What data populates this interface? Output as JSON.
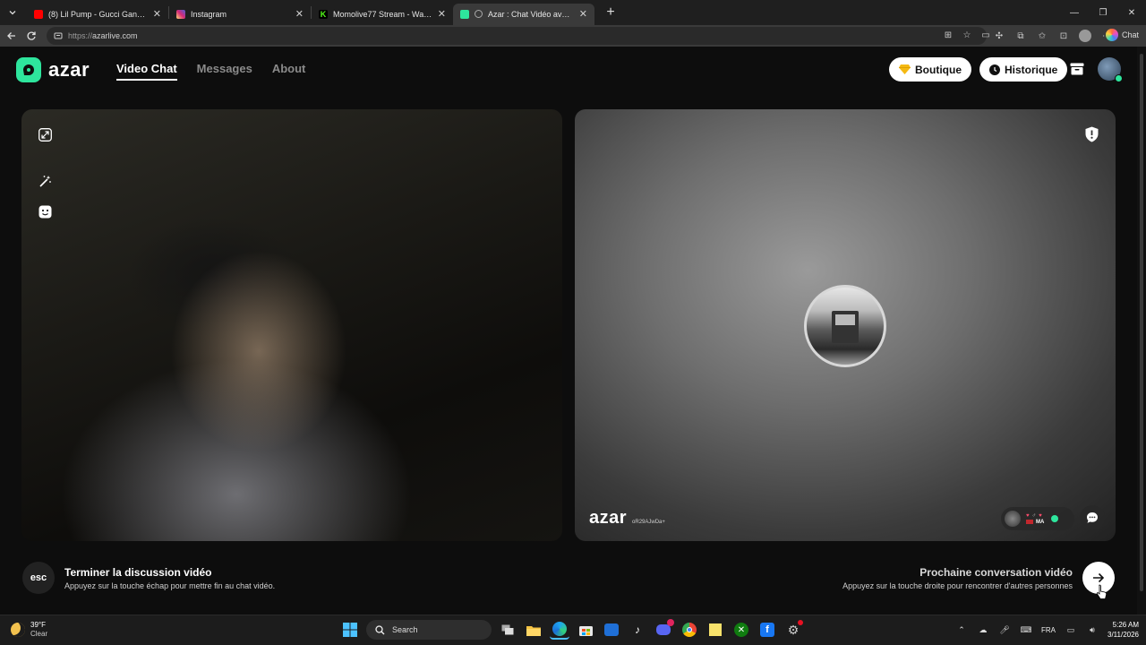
{
  "browser": {
    "tabs": [
      {
        "title": "(8) Lil Pump - Gucci Gang [Official",
        "icon": "youtube-icon",
        "color": "#ff0000"
      },
      {
        "title": "Instagram",
        "icon": "instagram-icon",
        "color": "#e1306c"
      },
      {
        "title": "Momolive77 Stream - Watch Live o",
        "icon": "kick-icon",
        "color": "#53fc18"
      },
      {
        "title": "Azar : Chat Vidéo avec de nou",
        "icon": "azar-icon",
        "color": "#2ee59d"
      }
    ],
    "url_prefix": "https://",
    "url_host": "azarlive.com",
    "copilot_label": "Chat"
  },
  "header": {
    "logo_text": "azar",
    "nav": [
      "Video Chat",
      "Messages",
      "About"
    ],
    "boutique_label": "Boutique",
    "historique_label": "Historique"
  },
  "peer": {
    "watermark": "azar",
    "id": "oR29AJwDa+",
    "country": "MA"
  },
  "footer": {
    "esc_label": "esc",
    "end_title": "Terminer la discussion vidéo",
    "end_sub": "Appuyez sur la touche échap pour mettre fin au chat vidéo.",
    "next_title": "Prochaine conversation vidéo",
    "next_sub": "Appuyez sur la touche droite pour rencontrer d'autres personnes"
  },
  "taskbar": {
    "temp": "39°F",
    "condition": "Clear",
    "search_placeholder": "Search",
    "lang": "FRA",
    "time": "5:26 AM",
    "date": "3/11/2026"
  },
  "colors": {
    "brand": "#2ee59d",
    "background": "#0d0d0d"
  }
}
